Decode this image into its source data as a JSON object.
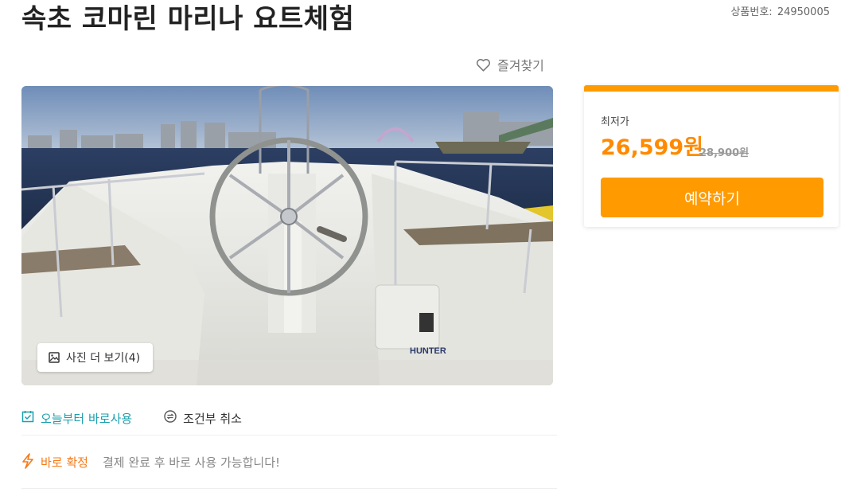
{
  "header": {
    "title": "속초 코마린 마리나 요트체험",
    "product_no_label": "상품번호:",
    "product_no": "24950005"
  },
  "favorite": {
    "label": "즐겨찾기",
    "icon": "heart-outline-icon"
  },
  "gallery": {
    "more_label": "사진 더 보기(4)",
    "icon": "image-icon",
    "photo_text": "HUNTER"
  },
  "features": [
    {
      "label": "오늘부터 바로사용",
      "icon": "calendar-check-icon",
      "color": "#1a9fae"
    },
    {
      "label": "조건부 취소",
      "icon": "exchange-icon",
      "color": "#333333"
    }
  ],
  "confirm": {
    "label": "바로 확정",
    "desc": "결제 완료 후 바로 사용 가능합니다!",
    "icon": "lightning-icon",
    "color": "#f57a18"
  },
  "price_card": {
    "label": "최저가",
    "price": "26,599원",
    "original_price": "28,900원",
    "button_label": "예약하기",
    "accent": "#ff9a00"
  }
}
